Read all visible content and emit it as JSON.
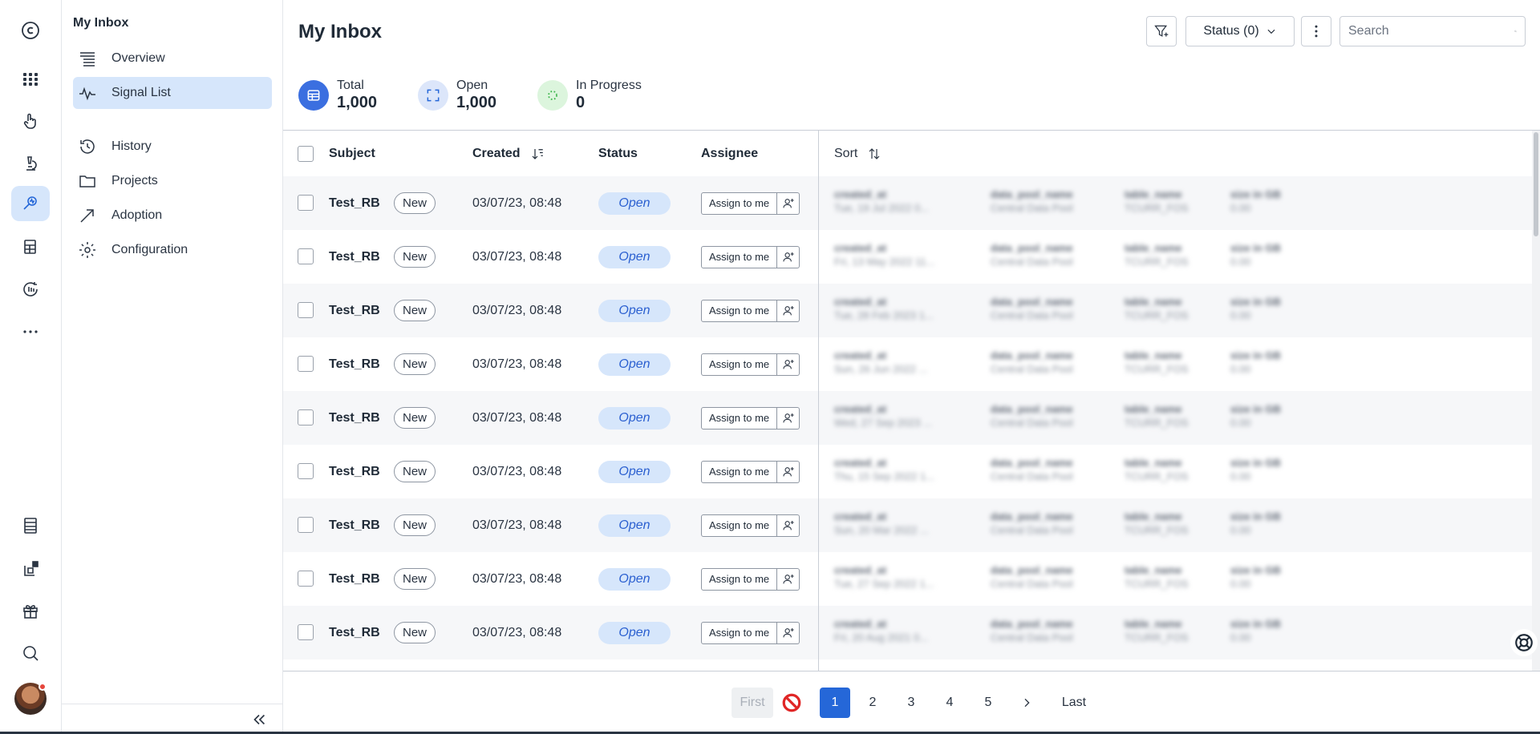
{
  "app": {
    "logo_letter": "C",
    "rail_icons": [
      "apps-grid-icon",
      "hand-pointer-icon",
      "microscope-icon",
      "signal-search-icon",
      "stacked-docs-icon",
      "refresh-data-icon",
      "more-horizontal-icon",
      "table-icon",
      "add-widget-icon",
      "gift-icon",
      "search-icon"
    ]
  },
  "subnav": {
    "title": "My Inbox",
    "items": [
      {
        "label": "Overview",
        "icon": "list-lines-icon"
      },
      {
        "label": "Signal List",
        "icon": "activity-icon",
        "active": true
      },
      {
        "label": "History",
        "icon": "history-icon"
      },
      {
        "label": "Projects",
        "icon": "folder-icon"
      },
      {
        "label": "Adoption",
        "icon": "trend-arrow-icon"
      },
      {
        "label": "Configuration",
        "icon": "gear-icon"
      }
    ]
  },
  "header": {
    "title": "My Inbox",
    "status_filter": "Status (0)",
    "search_placeholder": "Search"
  },
  "stats": [
    {
      "label": "Total",
      "value": "1,000",
      "color": "#2567d8"
    },
    {
      "label": "Open",
      "value": "1,000",
      "color": "#2567d8"
    },
    {
      "label": "In Progress",
      "value": "0",
      "color": "#3bb54a"
    }
  ],
  "table": {
    "columns": [
      "Subject",
      "Created",
      "Status",
      "Assignee"
    ],
    "right_header": "Sort",
    "rows": [
      {
        "subject": "Test_RB",
        "badge": "New",
        "created": "03/07/23, 08:48",
        "status": "Open",
        "assign": "Assign to me"
      },
      {
        "subject": "Test_RB",
        "badge": "New",
        "created": "03/07/23, 08:48",
        "status": "Open",
        "assign": "Assign to me"
      },
      {
        "subject": "Test_RB",
        "badge": "New",
        "created": "03/07/23, 08:48",
        "status": "Open",
        "assign": "Assign to me"
      },
      {
        "subject": "Test_RB",
        "badge": "New",
        "created": "03/07/23, 08:48",
        "status": "Open",
        "assign": "Assign to me"
      },
      {
        "subject": "Test_RB",
        "badge": "New",
        "created": "03/07/23, 08:48",
        "status": "Open",
        "assign": "Assign to me"
      },
      {
        "subject": "Test_RB",
        "badge": "New",
        "created": "03/07/23, 08:48",
        "status": "Open",
        "assign": "Assign to me"
      },
      {
        "subject": "Test_RB",
        "badge": "New",
        "created": "03/07/23, 08:48",
        "status": "Open",
        "assign": "Assign to me"
      },
      {
        "subject": "Test_RB",
        "badge": "New",
        "created": "03/07/23, 08:48",
        "status": "Open",
        "assign": "Assign to me"
      },
      {
        "subject": "Test_RB",
        "badge": "New",
        "created": "03/07/23, 08:48",
        "status": "Open",
        "assign": "Assign to me"
      }
    ],
    "blurred_rows": [
      [
        "created_at",
        "Tue, 19 Jul 2022 0...",
        "data_pool_name",
        "Central Data Pool",
        "table_name",
        "TCURR_FOS",
        "size in GB",
        "0.00"
      ],
      [
        "created_at",
        "Fri, 13 May 2022 11...",
        "data_pool_name",
        "Central Data Pool",
        "table_name",
        "TCURR_FOS",
        "size in GB",
        "0.00"
      ],
      [
        "created_at",
        "Tue, 28 Feb 2023 1...",
        "data_pool_name",
        "Central Data Pool",
        "table_name",
        "TCURR_FOS",
        "size in GB",
        "0.00"
      ],
      [
        "created_at",
        "Sun, 26 Jun 2022 ...",
        "data_pool_name",
        "Central Data Pool",
        "table_name",
        "TCURR_FOS",
        "size in GB",
        "0.00"
      ],
      [
        "created_at",
        "Wed, 27 Sep 2023 ...",
        "data_pool_name",
        "Central Data Pool",
        "table_name",
        "TCURR_FOS",
        "size in GB",
        "0.00"
      ],
      [
        "created_at",
        "Thu, 15 Sep 2022 1...",
        "data_pool_name",
        "Central Data Pool",
        "table_name",
        "TCURR_FOS",
        "size in GB",
        "0.00"
      ],
      [
        "created_at",
        "Sun, 20 Mar 2022 ...",
        "data_pool_name",
        "Central Data Pool",
        "table_name",
        "TCURR_FOS",
        "size in GB",
        "0.00"
      ],
      [
        "created_at",
        "Tue, 27 Sep 2022 1...",
        "data_pool_name",
        "Central Data Pool",
        "table_name",
        "TCURR_FOS",
        "size in GB",
        "0.00"
      ],
      [
        "created_at",
        "Fri, 20 Aug 2021 0...",
        "data_pool_name",
        "Central Data Pool",
        "table_name",
        "TCURR_FOS",
        "size in GB",
        "0.00"
      ]
    ]
  },
  "pagination": {
    "first": "First",
    "pages": [
      "1",
      "2",
      "3",
      "4",
      "5"
    ],
    "current": "1",
    "last": "Last"
  }
}
